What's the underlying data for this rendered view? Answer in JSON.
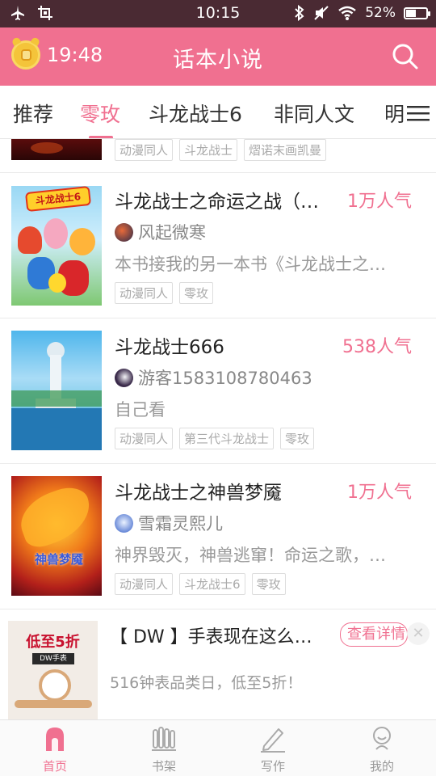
{
  "status_bar": {
    "time": "10:15",
    "battery": "52%",
    "battery_fraction": 0.52,
    "icons": [
      "airplane-icon",
      "screenshot-icon",
      "bluetooth-icon",
      "mute-icon",
      "wifi-icon",
      "battery-icon"
    ]
  },
  "header": {
    "clock_time": "19:48",
    "title": "话本小说",
    "search_icon": "search-icon"
  },
  "tabs": [
    {
      "label": "推荐",
      "active": false
    },
    {
      "label": "零玫",
      "active": true
    },
    {
      "label": "斗龙战士6",
      "active": false
    },
    {
      "label": "非同人文",
      "active": false
    },
    {
      "label": "明",
      "active": false
    }
  ],
  "tabs_menu_icon": "menu-icon",
  "partial_item": {
    "tags": [
      "动漫同人",
      "斗龙战士",
      "熠诺末画凯曼"
    ]
  },
  "books": [
    {
      "title": "斗龙战士之命运之战（…",
      "popularity": "1万人气",
      "author": "风起微寒",
      "description": "本书接我的另一本书《斗龙战士之…",
      "tags": [
        "动漫同人",
        "零玫"
      ]
    },
    {
      "title": "斗龙战士666",
      "popularity": "538人气",
      "author": "游客1583108780463",
      "description": "自己看",
      "tags": [
        "动漫同人",
        "第三代斗龙战士",
        "零玫"
      ]
    },
    {
      "title": "斗龙战士之神兽梦魇",
      "popularity": "1万人气",
      "author": "雪霜灵熙儿",
      "description": "神界毁灭，神兽逃窜！命运之歌，…",
      "tags": [
        "动漫同人",
        "斗龙战士6",
        "零玫"
      ]
    }
  ],
  "cover_texts": {
    "book1_logo": "斗龙战士6",
    "book3_caption": "神兽梦魇",
    "ad_banner": "低至5折",
    "ad_sub": "DW手表"
  },
  "ad": {
    "title": "【 DW 】手表现在这么…",
    "button": "查看详情",
    "close": "✕",
    "description": "516钟表品类日，低至5折！"
  },
  "bottom_nav": [
    {
      "label": "首页",
      "icon": "home-icon",
      "active": true
    },
    {
      "label": "书架",
      "icon": "bookshelf-icon",
      "active": false
    },
    {
      "label": "写作",
      "icon": "write-icon",
      "active": false
    },
    {
      "label": "我的",
      "icon": "profile-icon",
      "active": false
    }
  ],
  "colors": {
    "accent": "#f07090",
    "status_bar": "#4a2a33",
    "clock_icon": "#f4c43a"
  }
}
